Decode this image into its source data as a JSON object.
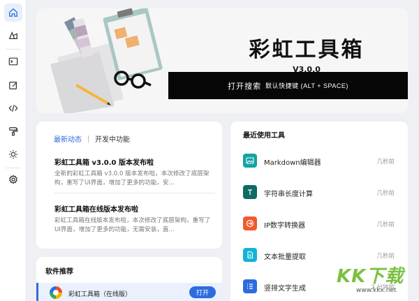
{
  "sidebar": {
    "items": [
      {
        "name": "home-icon",
        "active": true
      },
      {
        "name": "shapes-icon",
        "active": false
      },
      {
        "name": "terminal-icon",
        "active": false
      },
      {
        "name": "edit-icon",
        "active": false
      },
      {
        "name": "code-icon",
        "active": false
      },
      {
        "name": "paint-roller-icon",
        "active": false
      },
      {
        "name": "sun-icon",
        "active": false
      },
      {
        "name": "gear-icon",
        "active": false
      }
    ]
  },
  "hero": {
    "title": "彩虹工具箱",
    "version": "V3.0.0",
    "search_label": "打开搜索",
    "search_hint": "默认快捷键 (ALT + SPACE)"
  },
  "news": {
    "tabs": [
      {
        "label": "最新动态",
        "active": true
      },
      {
        "label": "开发中功能",
        "active": false
      }
    ],
    "items": [
      {
        "title": "彩虹工具箱 v3.0.0 版本发布啦",
        "desc": "全新的彩虹工具箱 v3.0.0 版本发布啦，本次修改了底层架构，重写了UI界面，增加了更多的功能，安..."
      },
      {
        "title": "彩虹工具箱在线版本发布啦",
        "desc": "彩虹工具箱在线版本发布啦，本次修改了底层架构，重写了UI界面，增加了更多的功能，无需安装，直..."
      }
    ]
  },
  "software": {
    "title": "软件推荐",
    "items": [
      {
        "name": "彩虹工具箱（在线版）",
        "action": "打开"
      }
    ]
  },
  "recent": {
    "title": "最近使用工具",
    "items": [
      {
        "name": "Markdown编辑器",
        "time": "几秒前",
        "color": "#14a3a3",
        "icon": "image-icon"
      },
      {
        "name": "字符串长度计算",
        "time": "几秒前",
        "color": "#0f6b63",
        "icon": "text-icon"
      },
      {
        "name": "IP数字转换器",
        "time": "几秒前",
        "color": "#f25a2c",
        "icon": "convert-icon"
      },
      {
        "name": "文本批量提取",
        "time": "几秒前",
        "color": "#12b3d6",
        "icon": "document-icon"
      },
      {
        "name": "竖排文字生成",
        "time": "2 分钟前",
        "color": "#2d6cdf",
        "icon": "list-icon"
      }
    ]
  },
  "watermark": {
    "text": "KK下载",
    "url": "www.kkx.net"
  },
  "colors": {
    "accent": "#2d6cdf",
    "search_bg": "#070707",
    "background": "#eef0f3"
  }
}
